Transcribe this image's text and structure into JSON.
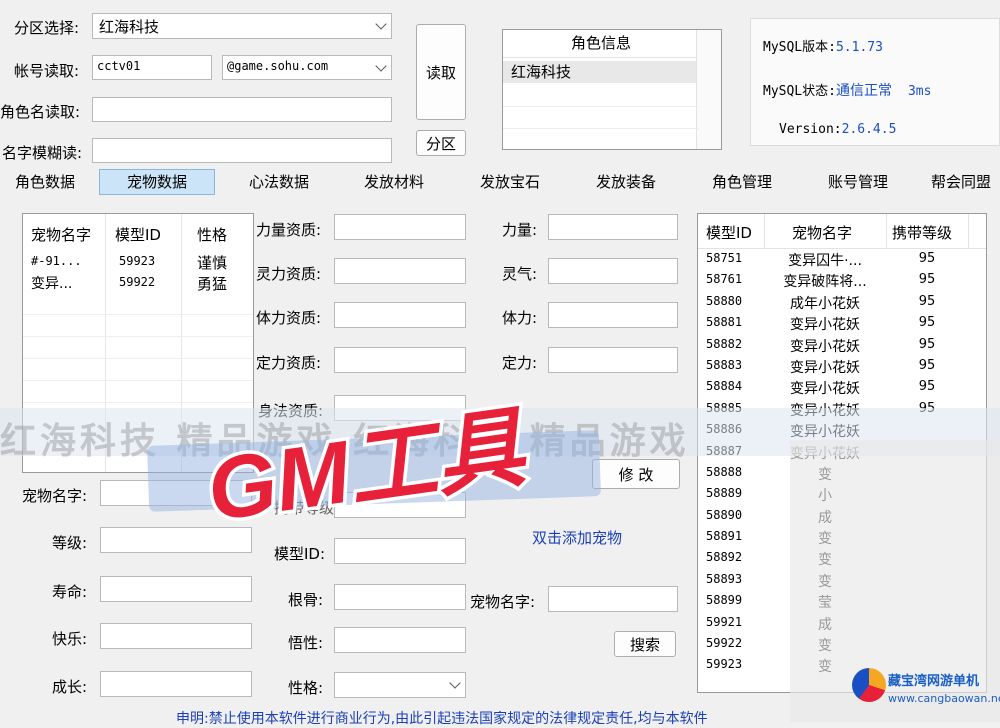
{
  "top": {
    "partition_label": "分区选择:",
    "partition_value": "红海科技",
    "account_label": "帐号读取:",
    "account_value": "cctv01",
    "account_domain": "@game.sohu.com",
    "role_name_label": "角色名读取:",
    "fuzzy_label": "名字模糊读:",
    "read_button": "读取",
    "partition_button": "分区"
  },
  "role_info": {
    "header": "角色信息",
    "rows": [
      "红海科技"
    ]
  },
  "mysql": {
    "version_label": "MySQL版本:",
    "version_value": "5.1.73",
    "status_label": "MySQL状态:",
    "status_value": "通信正常",
    "latency": "3ms",
    "app_version_label": "Version:",
    "app_version_value": "2.6.4.5"
  },
  "tabs": [
    "角色数据",
    "宠物数据",
    "心法数据",
    "发放材料",
    "发放宝石",
    "发放装备",
    "角色管理",
    "账号管理",
    "帮会同盟"
  ],
  "active_tab": "宠物数据",
  "pet_list": {
    "headers": [
      "宠物名字",
      "模型ID",
      "性格"
    ],
    "rows": [
      [
        "#-91...",
        "59923",
        "谨慎"
      ],
      [
        "变异...",
        "59922",
        "勇猛"
      ]
    ]
  },
  "attrs_left": [
    "力量资质:",
    "灵力资质:",
    "体力资质:",
    "定力资质:",
    "身法资质:"
  ],
  "attrs_mid": [
    "力量:",
    "灵气:",
    "体力:",
    "定力:"
  ],
  "edit_button": "修 改",
  "pet_form_left": [
    "宠物名字:",
    "等级:",
    "寿命:",
    "快乐:",
    "成长:"
  ],
  "pet_form_mid": [
    "携带等级:",
    "模型ID:",
    "根骨:",
    "悟性:",
    "性格:"
  ],
  "add_pet_hint": "双击添加宠物",
  "search_name_label": "宠物名字:",
  "search_button": "搜索",
  "model_list": {
    "headers": [
      "模型ID",
      "宠物名字",
      "携带等级"
    ],
    "rows": [
      [
        "58751",
        "变异囚牛·...",
        "95"
      ],
      [
        "58761",
        "变异破阵将...",
        "95"
      ],
      [
        "58880",
        "成年小花妖",
        "95"
      ],
      [
        "58881",
        "变异小花妖",
        "95"
      ],
      [
        "58882",
        "变异小花妖",
        "95"
      ],
      [
        "58883",
        "变异小花妖",
        "95"
      ],
      [
        "58884",
        "变异小花妖",
        "95"
      ],
      [
        "58885",
        "变异小花妖",
        "95"
      ],
      [
        "58886",
        "变异小花妖",
        ""
      ],
      [
        "58887",
        "变异小花妖",
        ""
      ],
      [
        "58888",
        "变",
        ""
      ],
      [
        "58889",
        "小",
        ""
      ],
      [
        "58890",
        "成",
        ""
      ],
      [
        "58891",
        "变",
        ""
      ],
      [
        "58892",
        "变",
        ""
      ],
      [
        "58893",
        "变",
        ""
      ],
      [
        "58899",
        "莹",
        ""
      ],
      [
        "59921",
        "成",
        ""
      ],
      [
        "59922",
        "变",
        ""
      ],
      [
        "59923",
        "变",
        ""
      ]
    ]
  },
  "footer_notice": "申明:禁止使用本软件进行商业行为,由此引起违法国家规定的法律规定责任,均与本软件",
  "watermark": {
    "band_text": "红海科技 精品游戏 红海科技 精品游戏",
    "logo_text": "GM工具",
    "site_name": "藏宝湾网游单机",
    "site_url": "www.cangbaowan.net"
  }
}
